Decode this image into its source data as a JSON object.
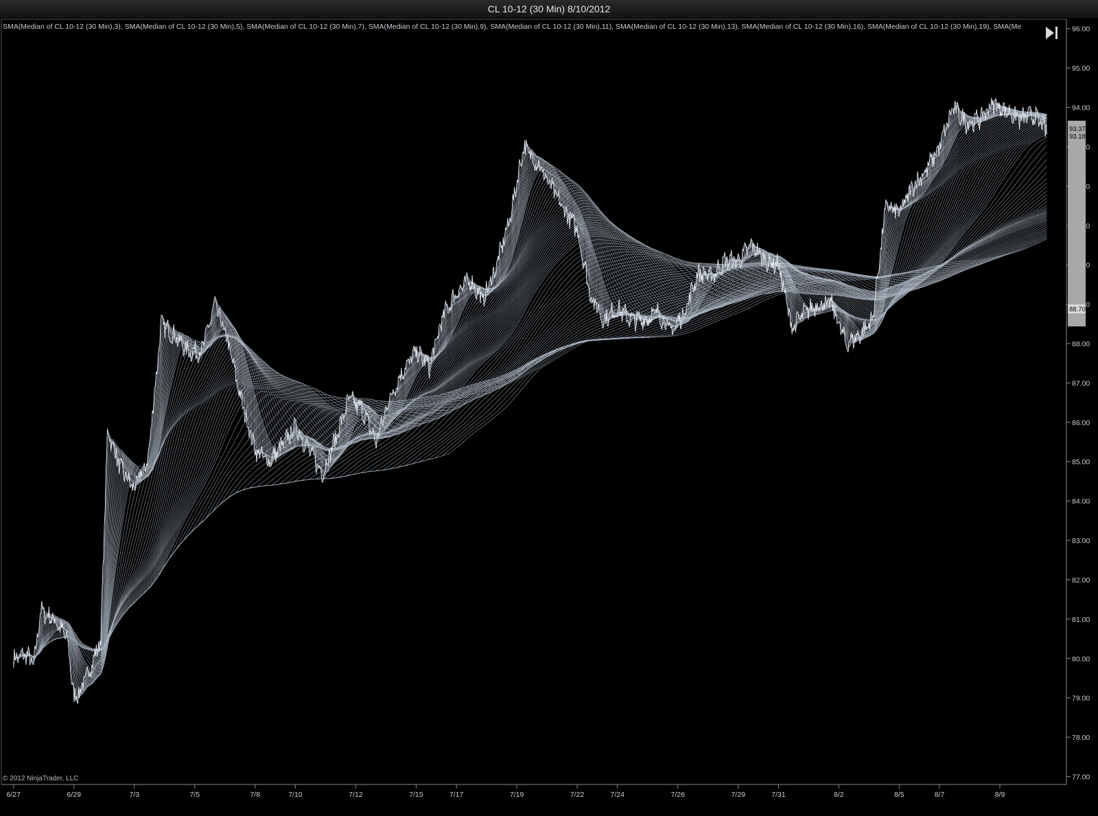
{
  "window": {
    "title": "CL 10-12 (30 Min)  8/10/2012"
  },
  "legend": {
    "text": "SMA(Median of CL 10-12 (30 Min),3), SMA(Median of CL 10-12 (30 Min),5), SMA(Median of CL 10-12 (30 Min),7), SMA(Median of CL 10-12 (30 Min),9), SMA(Median of CL 10-12 (30 Min),11), SMA(Median of CL 10-12 (30 Min),13), SMA(Median of CL 10-12 (30 Min),16), SMA(Median of CL 10-12 (30 Min),19), SMA(Me"
  },
  "copyright": "© 2012 NinjaTrader, LLC",
  "colors": {
    "background": "#000000",
    "line": "#c9d2dc",
    "ribbon": "#8a97a6",
    "price": "#e8eef4",
    "axis": "#9a9a9a",
    "last_box": "#a8a8a8"
  },
  "icons": {
    "skip_to_end": "skip-to-end-icon"
  },
  "chart_data": {
    "type": "line",
    "title": "CL 10-12 (30 Min)  8/10/2012",
    "xlabel": "",
    "ylabel": "",
    "ylim": [
      76.8,
      96.1
    ],
    "y_ticks": [
      "77.00",
      "78.00",
      "79.00",
      "80.00",
      "81.00",
      "82.00",
      "83.00",
      "84.00",
      "85.00",
      "86.00",
      "87.00",
      "88.00",
      "89.00",
      "90.00",
      "91.00",
      "92.00",
      "93.00",
      "94.00",
      "95.00",
      "96.00"
    ],
    "x_ticks": [
      "6/27",
      "6/29",
      "7/3",
      "7/5",
      "7/8",
      "7/10",
      "7/12",
      "7/15",
      "7/17",
      "7/19",
      "7/22",
      "7/24",
      "7/26",
      "7/29",
      "7/31",
      "8/2",
      "8/5",
      "8/7",
      "8/9"
    ],
    "x_tick_positions": [
      0,
      4.5,
      9,
      13.5,
      18,
      21,
      25.5,
      30,
      33,
      37.5,
      42,
      45,
      49.5,
      54,
      57,
      61.5,
      66,
      69,
      73.5
    ],
    "x_range": [
      -0.5,
      78
    ],
    "price_anchors": [
      [
        0,
        80.0
      ],
      [
        1,
        80.1
      ],
      [
        1.5,
        79.8
      ],
      [
        2,
        81.2
      ],
      [
        3,
        81.0
      ],
      [
        4,
        80.5
      ],
      [
        4.5,
        79.0
      ],
      [
        5,
        79.2
      ],
      [
        6,
        80.0
      ],
      [
        6.5,
        80.5
      ],
      [
        7,
        85.8
      ],
      [
        8,
        84.8
      ],
      [
        9,
        84.3
      ],
      [
        9.5,
        84.7
      ],
      [
        10,
        85.0
      ],
      [
        11,
        88.5
      ],
      [
        12,
        88.2
      ],
      [
        13,
        87.8
      ],
      [
        14,
        87.8
      ],
      [
        15,
        89.0
      ],
      [
        16,
        88.0
      ],
      [
        17,
        86.5
      ],
      [
        18,
        85.3
      ],
      [
        19,
        85.0
      ],
      [
        20,
        85.4
      ],
      [
        21,
        85.9
      ],
      [
        22,
        85.3
      ],
      [
        23,
        84.7
      ],
      [
        24,
        85.6
      ],
      [
        25,
        86.6
      ],
      [
        26,
        86.3
      ],
      [
        27,
        85.5
      ],
      [
        28,
        86.6
      ],
      [
        29,
        87.3
      ],
      [
        30,
        87.8
      ],
      [
        31,
        87.4
      ],
      [
        32,
        88.7
      ],
      [
        33,
        89.3
      ],
      [
        34,
        89.6
      ],
      [
        35,
        89.1
      ],
      [
        36,
        90.0
      ],
      [
        37,
        91.2
      ],
      [
        38,
        93.0
      ],
      [
        39,
        92.6
      ],
      [
        40,
        92.0
      ],
      [
        41,
        91.4
      ],
      [
        42,
        90.9
      ],
      [
        43,
        89.2
      ],
      [
        44,
        88.6
      ],
      [
        45,
        88.9
      ],
      [
        46,
        88.6
      ],
      [
        47,
        88.6
      ],
      [
        48,
        88.8
      ],
      [
        49,
        88.3
      ],
      [
        50,
        88.8
      ],
      [
        51,
        89.8
      ],
      [
        52,
        89.7
      ],
      [
        53,
        90.1
      ],
      [
        54,
        90.1
      ],
      [
        55,
        90.5
      ],
      [
        56,
        90.1
      ],
      [
        57,
        90.0
      ],
      [
        58,
        88.4
      ],
      [
        59,
        88.8
      ],
      [
        60,
        89.0
      ],
      [
        61,
        89.0
      ],
      [
        62,
        88.0
      ],
      [
        63,
        88.2
      ],
      [
        64,
        88.6
      ],
      [
        65,
        91.5
      ],
      [
        66,
        91.3
      ],
      [
        67,
        92.0
      ],
      [
        68,
        92.4
      ],
      [
        69,
        93.0
      ],
      [
        70,
        94.0
      ],
      [
        71,
        93.6
      ],
      [
        72,
        93.7
      ],
      [
        73,
        94.1
      ],
      [
        74,
        93.9
      ],
      [
        75,
        93.7
      ],
      [
        76,
        93.8
      ],
      [
        77,
        93.4
      ]
    ],
    "series": [
      {
        "period": 3,
        "last": 93.37
      },
      {
        "period": 5,
        "last": 93.18
      },
      {
        "period": 7
      },
      {
        "period": 9
      },
      {
        "period": 11
      },
      {
        "period": 13
      },
      {
        "period": 16
      },
      {
        "period": 19
      }
    ],
    "last_values": [
      "93.37",
      "93.18"
    ],
    "last_bottom_value": "88.70",
    "grid": false
  }
}
